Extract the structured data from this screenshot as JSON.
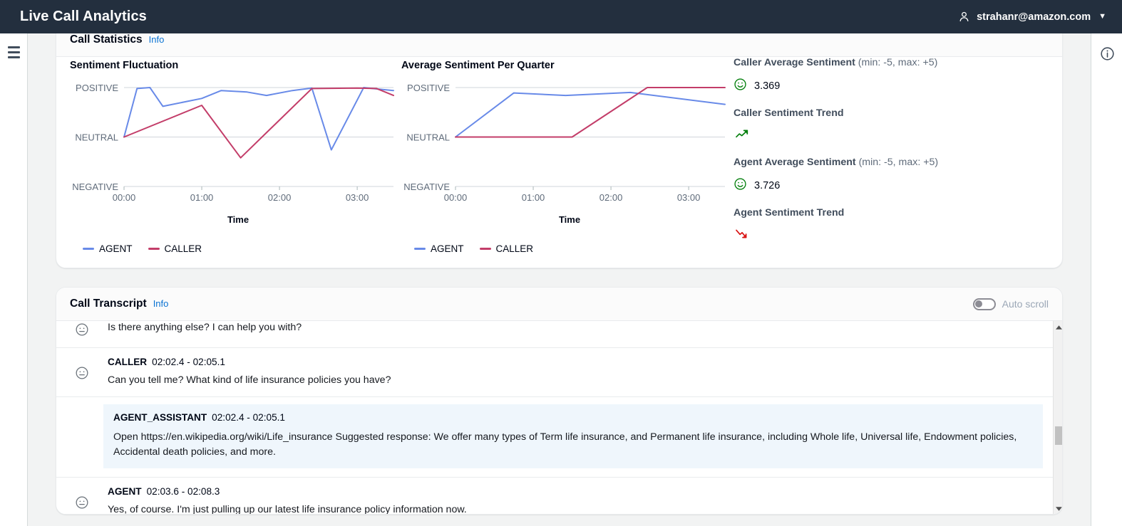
{
  "header": {
    "app_title": "Live Call Analytics",
    "user_email": "strahanr@amazon.com",
    "user_icon": "person-icon",
    "caret_icon": "chevron-down-icon",
    "menu_icon": "hamburger-menu-icon",
    "info_icon": "info-circle-icon"
  },
  "stats_panel": {
    "title": "Call Statistics",
    "info_label": "Info"
  },
  "transcript_panel": {
    "title": "Call Transcript",
    "info_label": "Info",
    "autoscroll_label": "Auto scroll",
    "autoscroll_on": false,
    "rows": [
      {
        "type": "utterance",
        "partial": true,
        "speaker": "",
        "time": "",
        "text": "Is there anything else? I can help you with?",
        "face": "neutral-face-icon"
      },
      {
        "type": "utterance",
        "partial": false,
        "speaker": "CALLER",
        "time": "02:02.4 - 02:05.1",
        "text": "Can you tell me? What kind of life insurance policies you have?",
        "face": "neutral-face-icon"
      },
      {
        "type": "assistant",
        "speaker": "AGENT_ASSISTANT",
        "time": "02:02.4 - 02:05.1",
        "text": "Open https://en.wikipedia.org/wiki/Life_insurance Suggested response: We offer many types of Term life insurance, and Permanent life insurance, including Whole life, Universal life, Endowment policies, Accidental death policies, and more."
      },
      {
        "type": "utterance",
        "partial": false,
        "speaker": "AGENT",
        "time": "02:03.6 - 02:08.3",
        "text": "Yes, of course. I'm just pulling up our latest life insurance policy information now.",
        "face": "neutral-face-icon"
      }
    ]
  },
  "metrics": {
    "caller_avg_label": "Caller Average Sentiment",
    "caller_avg_range": "(min: -5, max: +5)",
    "caller_avg_value": "3.369",
    "caller_avg_face": "smiley-face-icon",
    "caller_trend_label": "Caller Sentiment Trend",
    "caller_trend_icon": "trend-up-icon",
    "caller_trend_color": "#037f0c",
    "agent_avg_label": "Agent Average Sentiment",
    "agent_avg_range": "(min: -5, max: +5)",
    "agent_avg_value": "3.726",
    "agent_avg_face": "smiley-face-icon",
    "agent_trend_label": "Agent Sentiment Trend",
    "agent_trend_icon": "trend-down-icon",
    "agent_trend_color": "#d91515"
  },
  "colors": {
    "agent": "#688ae8",
    "caller": "#c33d69",
    "header_bg": "#232f3e",
    "page_bg": "#f2f3f3",
    "accent_link": "#0972d3",
    "positive": "#037f0c",
    "negative": "#d91515"
  },
  "chart_data": [
    {
      "type": "line",
      "title": "Sentiment Fluctuation",
      "xlabel": "Time",
      "ylabel": "",
      "ytick_labels": [
        "POSITIVE",
        "NEUTRAL",
        "NEGATIVE"
      ],
      "ytick_values": [
        5,
        0,
        -5
      ],
      "ylim": [
        -5,
        5
      ],
      "xtick_labels": [
        "00:00",
        "01:00",
        "02:00",
        "03:00"
      ],
      "xtick_values": [
        0,
        60,
        120,
        180
      ],
      "xlim": [
        0,
        208
      ],
      "grid": true,
      "legend_position": "bottom-left",
      "series": [
        {
          "name": "AGENT",
          "color": "#688ae8",
          "points": [
            {
              "x": 0,
              "y": 0.0
            },
            {
              "x": 10,
              "y": 4.9
            },
            {
              "x": 20,
              "y": 5.0
            },
            {
              "x": 30,
              "y": 3.1
            },
            {
              "x": 60,
              "y": 3.9
            },
            {
              "x": 75,
              "y": 4.7
            },
            {
              "x": 95,
              "y": 4.55
            },
            {
              "x": 110,
              "y": 4.2
            },
            {
              "x": 130,
              "y": 4.7
            },
            {
              "x": 145,
              "y": 4.95
            },
            {
              "x": 160,
              "y": -1.3
            },
            {
              "x": 185,
              "y": 5.0
            },
            {
              "x": 196,
              "y": 4.85
            },
            {
              "x": 208,
              "y": 4.7
            }
          ]
        },
        {
          "name": "CALLER",
          "color": "#c33d69",
          "points": [
            {
              "x": 0,
              "y": 0.0
            },
            {
              "x": 60,
              "y": 3.2
            },
            {
              "x": 90,
              "y": -2.1
            },
            {
              "x": 145,
              "y": 4.9
            },
            {
              "x": 180,
              "y": 4.95
            },
            {
              "x": 195,
              "y": 4.9
            },
            {
              "x": 208,
              "y": 4.2
            }
          ]
        }
      ]
    },
    {
      "type": "line",
      "title": "Average Sentiment Per Quarter",
      "xlabel": "Time",
      "ylabel": "",
      "ytick_labels": [
        "POSITIVE",
        "NEUTRAL",
        "NEGATIVE"
      ],
      "ytick_values": [
        5,
        0,
        -5
      ],
      "ylim": [
        -5,
        5
      ],
      "xtick_labels": [
        "00:00",
        "01:00",
        "02:00",
        "03:00"
      ],
      "xtick_values": [
        0,
        60,
        120,
        180
      ],
      "xlim": [
        0,
        208
      ],
      "grid": true,
      "legend_position": "bottom-left",
      "series": [
        {
          "name": "AGENT",
          "color": "#688ae8",
          "points": [
            {
              "x": 0,
              "y": 0.0
            },
            {
              "x": 45,
              "y": 4.45
            },
            {
              "x": 85,
              "y": 4.2
            },
            {
              "x": 135,
              "y": 4.5
            },
            {
              "x": 208,
              "y": 3.3
            }
          ]
        },
        {
          "name": "CALLER",
          "color": "#c33d69",
          "points": [
            {
              "x": 0,
              "y": 0.0
            },
            {
              "x": 90,
              "y": 0.0
            },
            {
              "x": 148,
              "y": 5.0
            },
            {
              "x": 208,
              "y": 5.0
            }
          ]
        }
      ]
    }
  ]
}
